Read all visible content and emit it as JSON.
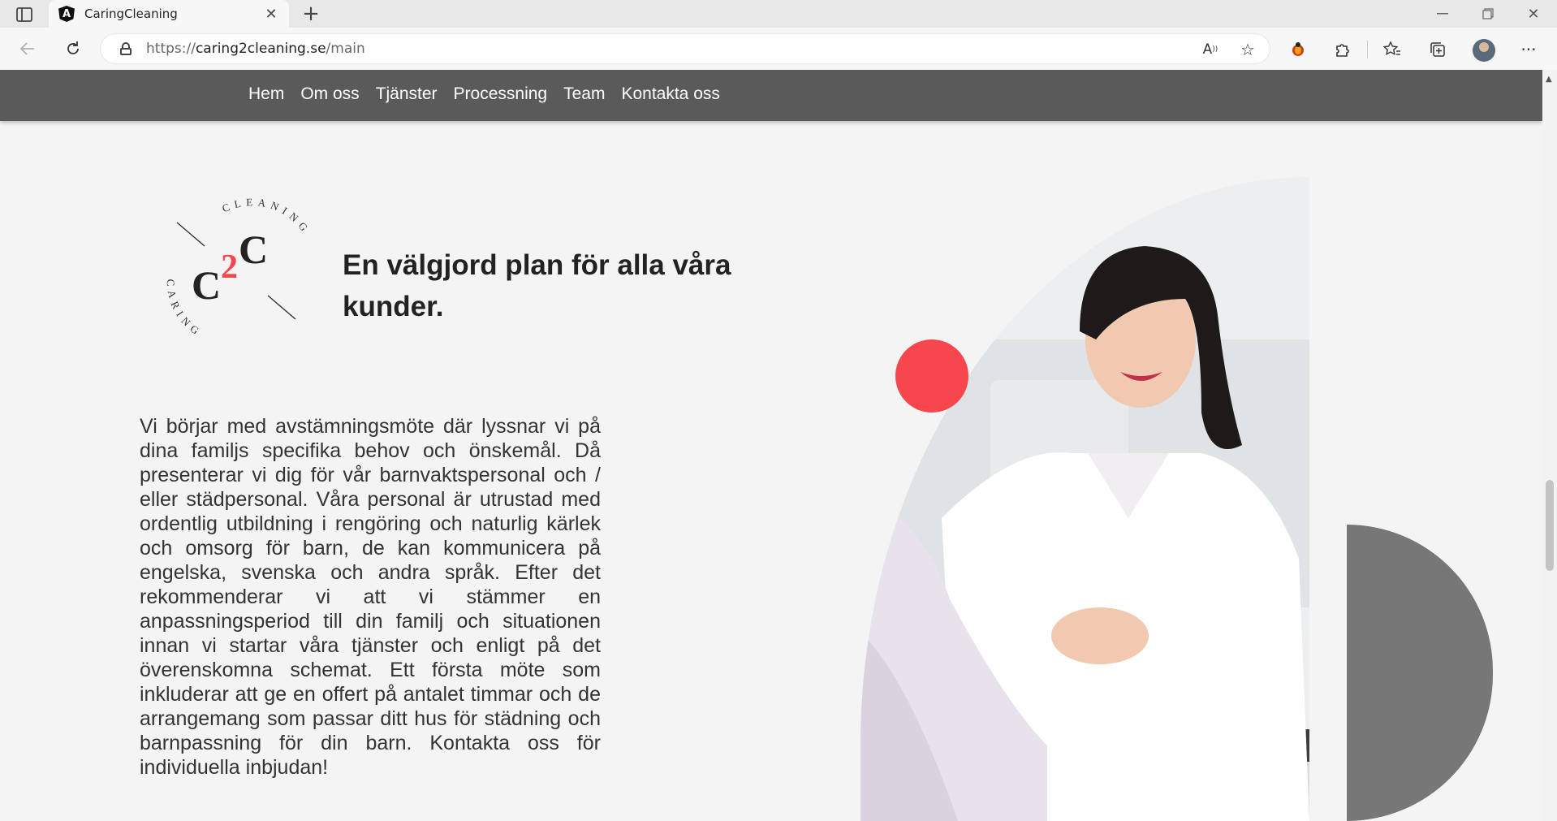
{
  "browser": {
    "tab_title": "CaringCleaning",
    "favicon_letter": "A",
    "url_prefix": "https://",
    "url_host": "caring2cleaning.se",
    "url_path": "/main"
  },
  "nav": {
    "items": [
      {
        "label": "Hem"
      },
      {
        "label": "Om oss"
      },
      {
        "label": "Tjänster"
      },
      {
        "label": "Processning"
      },
      {
        "label": "Team"
      },
      {
        "label": "Kontakta oss"
      }
    ]
  },
  "logo": {
    "arc_top": "CLEANING",
    "arc_bottom": "CARING",
    "letter_left": "C",
    "numeral": "2",
    "letter_right": "C"
  },
  "hero": {
    "heading_line1": "En välgjord plan för alla våra",
    "heading_line2": "kunder.",
    "body": "Vi börjar med avstämningsmöte där lyssnar vi på dina familjs specifika behov och önskemål. Då presenterar vi dig för vår barnvaktspersonal och / eller städpersonal. Våra personal är utrustad med ordentlig utbildning i rengöring och naturlig kärlek och omsorg för barn, de kan kommunicera på engelska, svenska och andra språk. Efter det rekommenderar vi att vi stämmer en anpassningsperiod till din familj och situationen innan vi startar våra tjänster och enligt på det överenskomna schemat. Ett första möte som inkluderar att ge en offert på antalet timmar och de arrangemang som passar ditt hus för städning och barnpassning för din barn. Kontakta oss för individuella inbjudan!"
  },
  "colors": {
    "nav_bg": "#5a5a5a",
    "accent_red": "#f6474e",
    "accent_gray": "#777777"
  },
  "icons": {
    "tab_actions": "tab-actions-icon",
    "close": "close-icon",
    "new_tab": "plus-icon",
    "back": "back-arrow-icon",
    "reload": "reload-icon",
    "lock": "lock-icon",
    "read_aloud": "read-aloud-icon",
    "add_favorite": "star-plus-icon",
    "extension": "extension-bug-icon",
    "extensions": "puzzle-icon",
    "favorites": "favorites-icon",
    "collections": "collections-icon",
    "more": "more-icon"
  }
}
